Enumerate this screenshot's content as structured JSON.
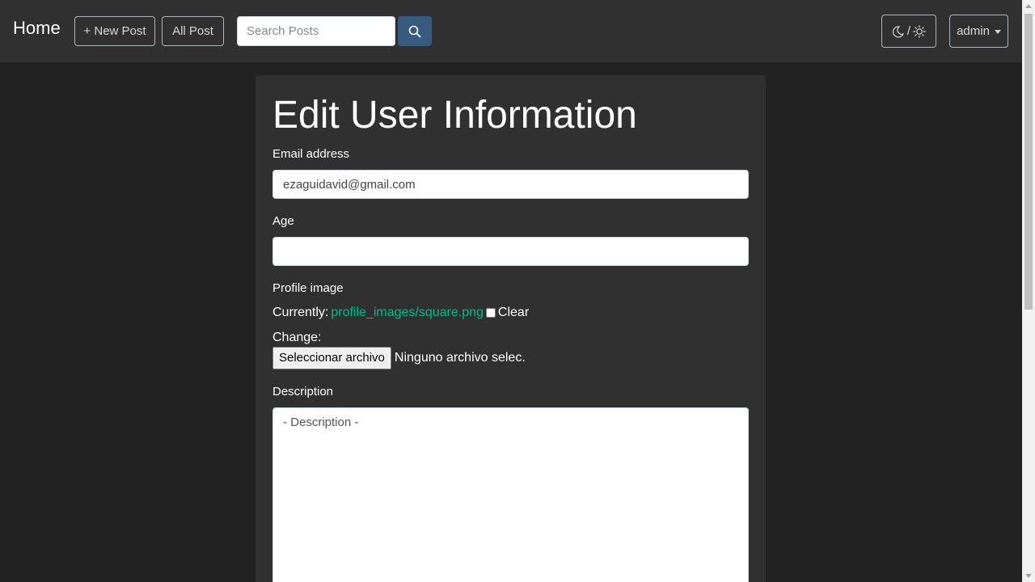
{
  "navbar": {
    "brand": "Home",
    "new_post_label": "+ New Post",
    "all_post_label": "All Post",
    "search_placeholder": "Search Posts",
    "theme_toggle_separator": "/",
    "user_menu_label": "admin"
  },
  "form": {
    "title": "Edit User Information",
    "email_label": "Email address",
    "email_value": "ezaguidavid@gmail.com",
    "age_label": "Age",
    "age_value": "",
    "profile_image_label": "Profile image",
    "currently_label": "Currently:",
    "current_image_link": "profile_images/square.png",
    "clear_label": "Clear",
    "change_label": "Change:",
    "file_button_label": "Seleccionar archivo",
    "file_status": "Ninguno archivo selec.",
    "description_label": "Description",
    "description_placeholder": "- Description -"
  },
  "colors": {
    "page_bg": "#222222",
    "navbar_bg": "#303030",
    "card_bg": "#303030",
    "search_button": "#375a7f",
    "link": "#00bc8c"
  },
  "icons": {
    "search": "search-icon",
    "moon": "moon-icon",
    "sun": "sun-icon",
    "caret": "caret-down-icon"
  }
}
